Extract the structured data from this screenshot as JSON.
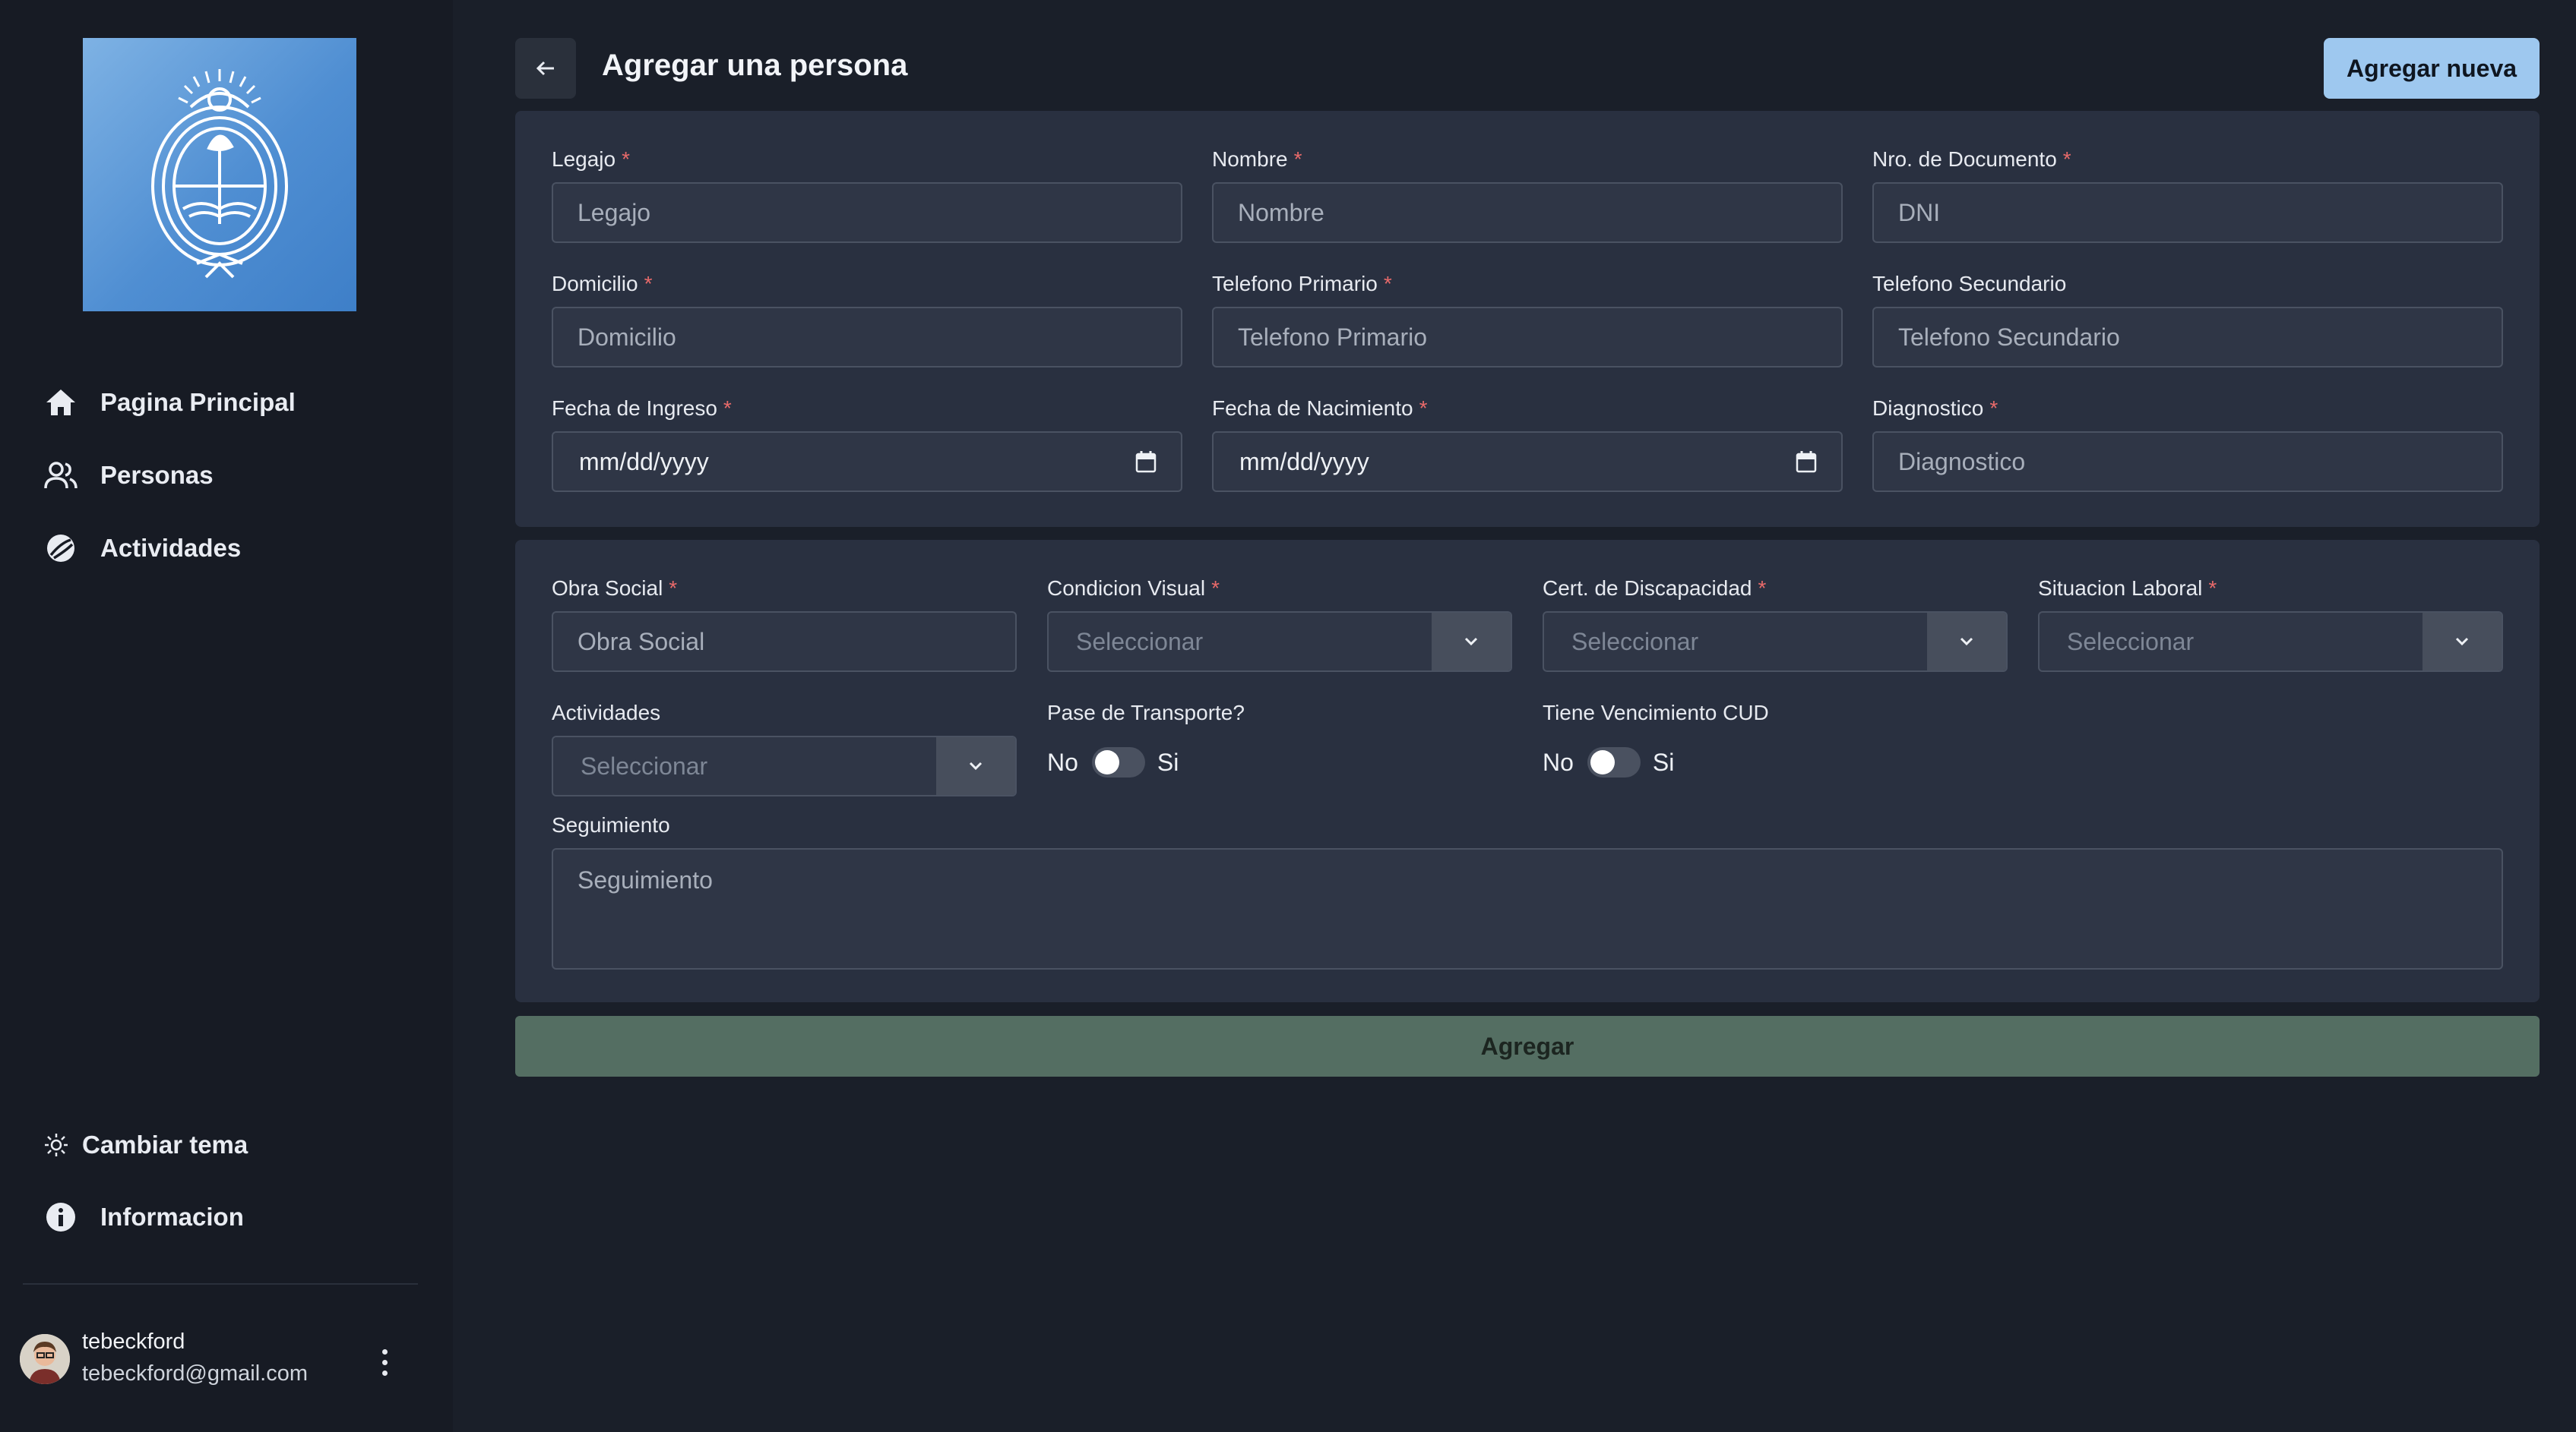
{
  "sidebar": {
    "logo_icon": "argentina-coat-of-arms",
    "nav": [
      {
        "label": "Pagina Principal",
        "icon": "home-icon"
      },
      {
        "label": "Personas",
        "icon": "users-icon"
      },
      {
        "label": "Actividades",
        "icon": "activities-icon"
      }
    ],
    "bottom": [
      {
        "label": "Cambiar tema",
        "icon": "sun-icon"
      },
      {
        "label": "Informacion",
        "icon": "info-icon"
      }
    ],
    "user": {
      "name": "tebeckford",
      "email": "tebeckford@gmail.com"
    }
  },
  "header": {
    "title": "Agregar una persona",
    "new_button": "Agregar nueva"
  },
  "form1": {
    "legajo": {
      "label": "Legajo",
      "placeholder": "Legajo"
    },
    "nombre": {
      "label": "Nombre",
      "placeholder": "Nombre"
    },
    "documento": {
      "label": "Nro. de Documento",
      "placeholder": "DNI"
    },
    "domicilio": {
      "label": "Domicilio",
      "placeholder": "Domicilio"
    },
    "tel1": {
      "label": "Telefono Primario",
      "placeholder": "Telefono Primario"
    },
    "tel2": {
      "label": "Telefono Secundario",
      "placeholder": "Telefono Secundario"
    },
    "ingreso": {
      "label": "Fecha de Ingreso",
      "value": "mm/dd/yyyy"
    },
    "nacimiento": {
      "label": "Fecha de Nacimiento",
      "value": "mm/dd/yyyy"
    },
    "diagnostico": {
      "label": "Diagnostico",
      "placeholder": "Diagnostico"
    }
  },
  "form2": {
    "obra_social": {
      "label": "Obra Social",
      "placeholder": "Obra Social"
    },
    "condicion_visual": {
      "label": "Condicion Visual",
      "value": "Seleccionar"
    },
    "cert_discapacidad": {
      "label": "Cert. de Discapacidad",
      "value": "Seleccionar"
    },
    "situacion_laboral": {
      "label": "Situacion Laboral",
      "value": "Seleccionar"
    },
    "actividades": {
      "label": "Actividades",
      "value": "Seleccionar"
    },
    "pase_transporte": {
      "label": "Pase de Transporte?",
      "off": "No",
      "on": "Si"
    },
    "vencimiento_cud": {
      "label": "Tiene Vencimiento CUD",
      "off": "No",
      "on": "Si"
    },
    "seguimiento": {
      "label": "Seguimiento",
      "placeholder": "Seguimiento"
    }
  },
  "submit": "Agregar",
  "required_mark": "*",
  "colors": {
    "background": "#1a1f29",
    "sidebar": "#171b24",
    "card": "#293040",
    "accent": "#9ec8ef",
    "submit": "#546e62",
    "required": "#e86a6a"
  }
}
